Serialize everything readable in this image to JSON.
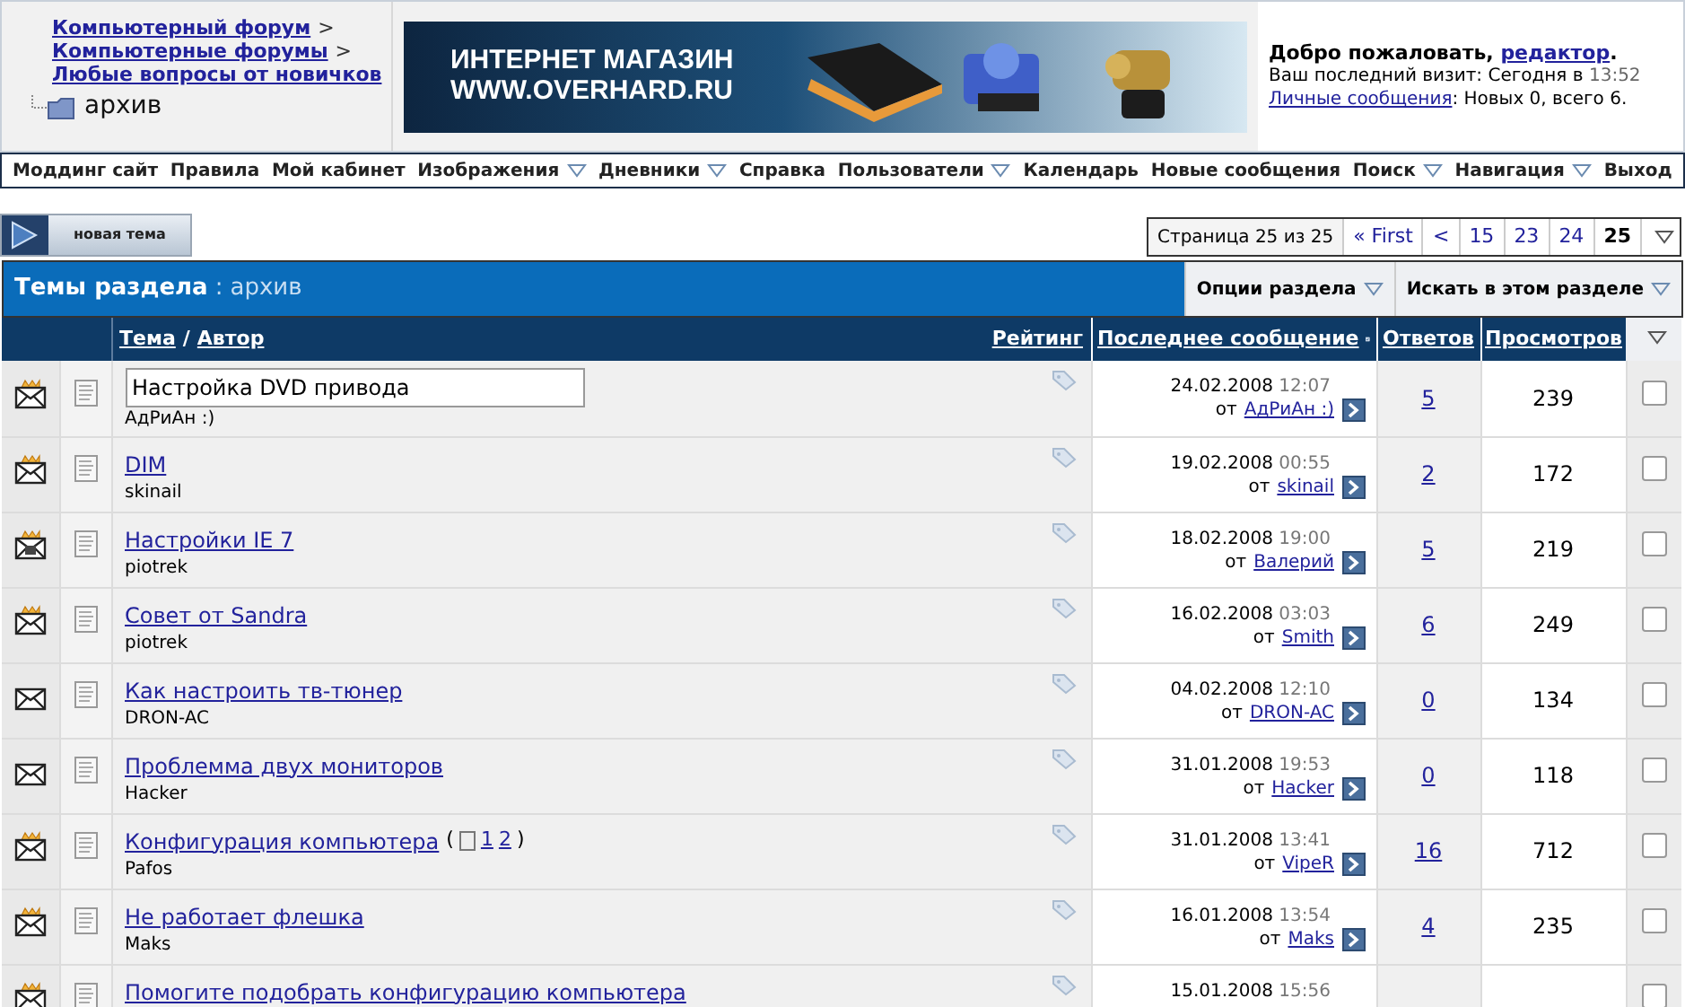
{
  "breadcrumbs": {
    "links": [
      "Компьютерный форум",
      "Компьютерные форумы",
      "Любые вопросы от новичков"
    ],
    "separator": ">",
    "current": "архив"
  },
  "banner": {
    "line1": "ИНТЕРНЕТ МАГАЗИН",
    "line2": "WWW.OVERHARD.RU"
  },
  "welcome": {
    "greeting": "Добро пожаловать,",
    "user": "редактор",
    "greeting_end": ".",
    "last_visit_label": "Ваш последний визит: Сегодня в",
    "last_visit_time": "13:52",
    "pm_link": "Личные сообщения",
    "pm_text": ": Новых 0, всего 6."
  },
  "navbar": [
    {
      "label": "Моддинг сайт",
      "dropdown": false
    },
    {
      "label": "Правила",
      "dropdown": false
    },
    {
      "label": "Мой кабинет",
      "dropdown": false
    },
    {
      "label": "Изображения",
      "dropdown": true
    },
    {
      "label": "Дневники",
      "dropdown": true
    },
    {
      "label": "Справка",
      "dropdown": false
    },
    {
      "label": "Пользователи",
      "dropdown": true
    },
    {
      "label": "Календарь",
      "dropdown": false
    },
    {
      "label": "Новые сообщения",
      "dropdown": false
    },
    {
      "label": "Поиск",
      "dropdown": true
    },
    {
      "label": "Навигация",
      "dropdown": true
    },
    {
      "label": "Выход",
      "dropdown": false
    }
  ],
  "new_topic_button": "новая тема",
  "pagination": {
    "label": "Страница 25 из 25",
    "first": "« First",
    "prev": "<",
    "pages": [
      {
        "label": "15",
        "selected": false
      },
      {
        "label": "23",
        "selected": false
      },
      {
        "label": "24",
        "selected": false
      },
      {
        "label": "25",
        "selected": true
      }
    ]
  },
  "section": {
    "title": "Темы раздела",
    "separator": ":",
    "name": "архив",
    "options": [
      "Опции раздела",
      "Искать в этом разделе"
    ]
  },
  "table": {
    "columns": {
      "topic": "Тема",
      "slash": "/",
      "author": "Автор",
      "rating": "Рейтинг",
      "last_post": "Последнее сообщение",
      "replies": "Ответов",
      "views": "Просмотров"
    },
    "rows": [
      {
        "kind": "hot",
        "title": "Настройка DVD привода",
        "editing": true,
        "author": "АдРиАн :)",
        "date": "24.02.2008",
        "time": "12:07",
        "by": "от",
        "last_user": "АдРиАн :)",
        "replies": "5",
        "views": "239",
        "checked": false
      },
      {
        "kind": "hot",
        "title": "DIM",
        "editing": false,
        "author": "skinail",
        "date": "19.02.2008",
        "time": "00:55",
        "by": "от",
        "last_user": "skinail",
        "replies": "2",
        "views": "172",
        "checked": false
      },
      {
        "kind": "locked",
        "title": "Настройки IE 7",
        "editing": false,
        "author": "piotrek",
        "date": "18.02.2008",
        "time": "19:00",
        "by": "от",
        "last_user": "Валерий",
        "replies": "5",
        "views": "219",
        "checked": false
      },
      {
        "kind": "hot",
        "title": "Совет от Sandra",
        "editing": false,
        "author": "piotrek",
        "date": "16.02.2008",
        "time": "03:03",
        "by": "от",
        "last_user": "Smith",
        "replies": "6",
        "views": "249",
        "checked": false
      },
      {
        "kind": "normal",
        "title": "Как настроить тв-тюнер",
        "editing": false,
        "author": "DRON-AC",
        "date": "04.02.2008",
        "time": "12:10",
        "by": "от",
        "last_user": "DRON-AC",
        "replies": "0",
        "views": "134",
        "checked": false
      },
      {
        "kind": "normal",
        "title": "Проблемма двух мониторов",
        "editing": false,
        "author": "Hacker",
        "date": "31.01.2008",
        "time": "19:53",
        "by": "от",
        "last_user": "Hacker",
        "replies": "0",
        "views": "118",
        "checked": false
      },
      {
        "kind": "hot",
        "title": "Конфигурация компьютера",
        "editing": false,
        "pages": [
          "1",
          "2"
        ],
        "pages_open": "(",
        "pages_close": ")",
        "author": "Pafos",
        "date": "31.01.2008",
        "time": "13:41",
        "by": "от",
        "last_user": "VipeR",
        "replies": "16",
        "views": "712",
        "checked": false
      },
      {
        "kind": "hot",
        "title": "Не работает флешка",
        "editing": false,
        "author": "Maks",
        "date": "16.01.2008",
        "time": "13:54",
        "by": "от",
        "last_user": "Maks",
        "replies": "4",
        "views": "235",
        "checked": false
      },
      {
        "kind": "hot",
        "title": "Помогите подобрать конфигурацию компьютера",
        "editing": false,
        "date": "15.01.2008",
        "time": "15:56",
        "checked": false
      }
    ]
  }
}
